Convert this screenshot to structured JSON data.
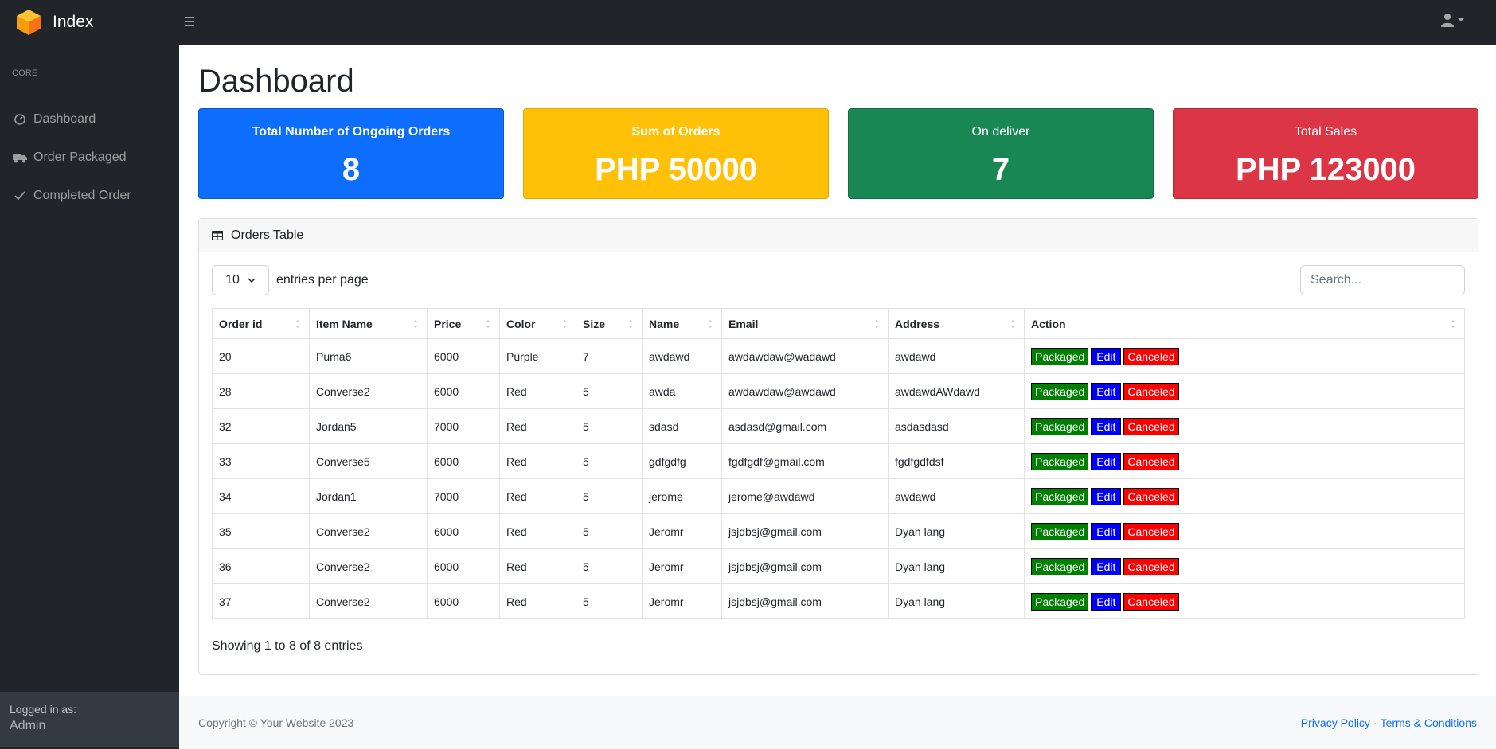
{
  "brand": {
    "name": "Index"
  },
  "sidebar": {
    "heading": "CORE",
    "items": [
      {
        "label": "Dashboard",
        "icon": "dashboard-gauge-icon"
      },
      {
        "label": "Order Packaged",
        "icon": "truck-icon"
      },
      {
        "label": "Completed Order",
        "icon": "check-icon"
      }
    ],
    "footer": {
      "logged_label": "Logged in as:",
      "user": "Admin"
    }
  },
  "main": {
    "title": "Dashboard",
    "cards": [
      {
        "title": "Total Number of Ongoing Orders",
        "value": "8",
        "color": "#0d6efd"
      },
      {
        "title": "Sum of Orders",
        "value": "PHP 50000",
        "color": "#ffc107"
      },
      {
        "title": "On deliver",
        "value": "7",
        "color": "#198754"
      },
      {
        "title": "Total Sales",
        "value": "PHP 123000",
        "color": "#dc3545"
      }
    ]
  },
  "orders": {
    "title": "Orders Table",
    "per_page": "10",
    "per_page_label": "entries per page",
    "search_placeholder": "Search...",
    "columns": [
      "Order id",
      "Item Name",
      "Price",
      "Color",
      "Size",
      "Name",
      "Email",
      "Address",
      "Action"
    ],
    "rows": [
      [
        "20",
        "Puma6",
        "6000",
        "Purple",
        "7",
        "awdawd",
        "awdawdaw@wadawd",
        "awdawd"
      ],
      [
        "28",
        "Converse2",
        "6000",
        "Red",
        "5",
        "awda",
        "awdawdaw@awdawd",
        "awdawdAWdawd"
      ],
      [
        "32",
        "Jordan5",
        "7000",
        "Red",
        "5",
        "sdasd",
        "asdasd@gmail.com",
        "asdasdasd"
      ],
      [
        "33",
        "Converse5",
        "6000",
        "Red",
        "5",
        "gdfgdfg",
        "fgdfgdf@gmail.com",
        "fgdfgdfdsf"
      ],
      [
        "34",
        "Jordan1",
        "7000",
        "Red",
        "5",
        "jerome",
        "jerome@awdawd",
        "awdawd"
      ],
      [
        "35",
        "Converse2",
        "6000",
        "Red",
        "5",
        "Jeromr",
        "jsjdbsj@gmail.com",
        "Dyan lang"
      ],
      [
        "36",
        "Converse2",
        "6000",
        "Red",
        "5",
        "Jeromr",
        "jsjdbsj@gmail.com",
        "Dyan lang"
      ],
      [
        "37",
        "Converse2",
        "6000",
        "Red",
        "5",
        "Jeromr",
        "jsjdbsj@gmail.com",
        "Dyan lang"
      ]
    ],
    "actions": {
      "packaged": "Packaged",
      "edit": "Edit",
      "canceled": "Canceled"
    },
    "showing": "Showing 1 to 8 of 8 entries"
  },
  "footer": {
    "copyright": "Copyright © Your Website 2023",
    "privacy": "Privacy Policy",
    "separator": "·",
    "terms": "Terms & Conditions"
  }
}
